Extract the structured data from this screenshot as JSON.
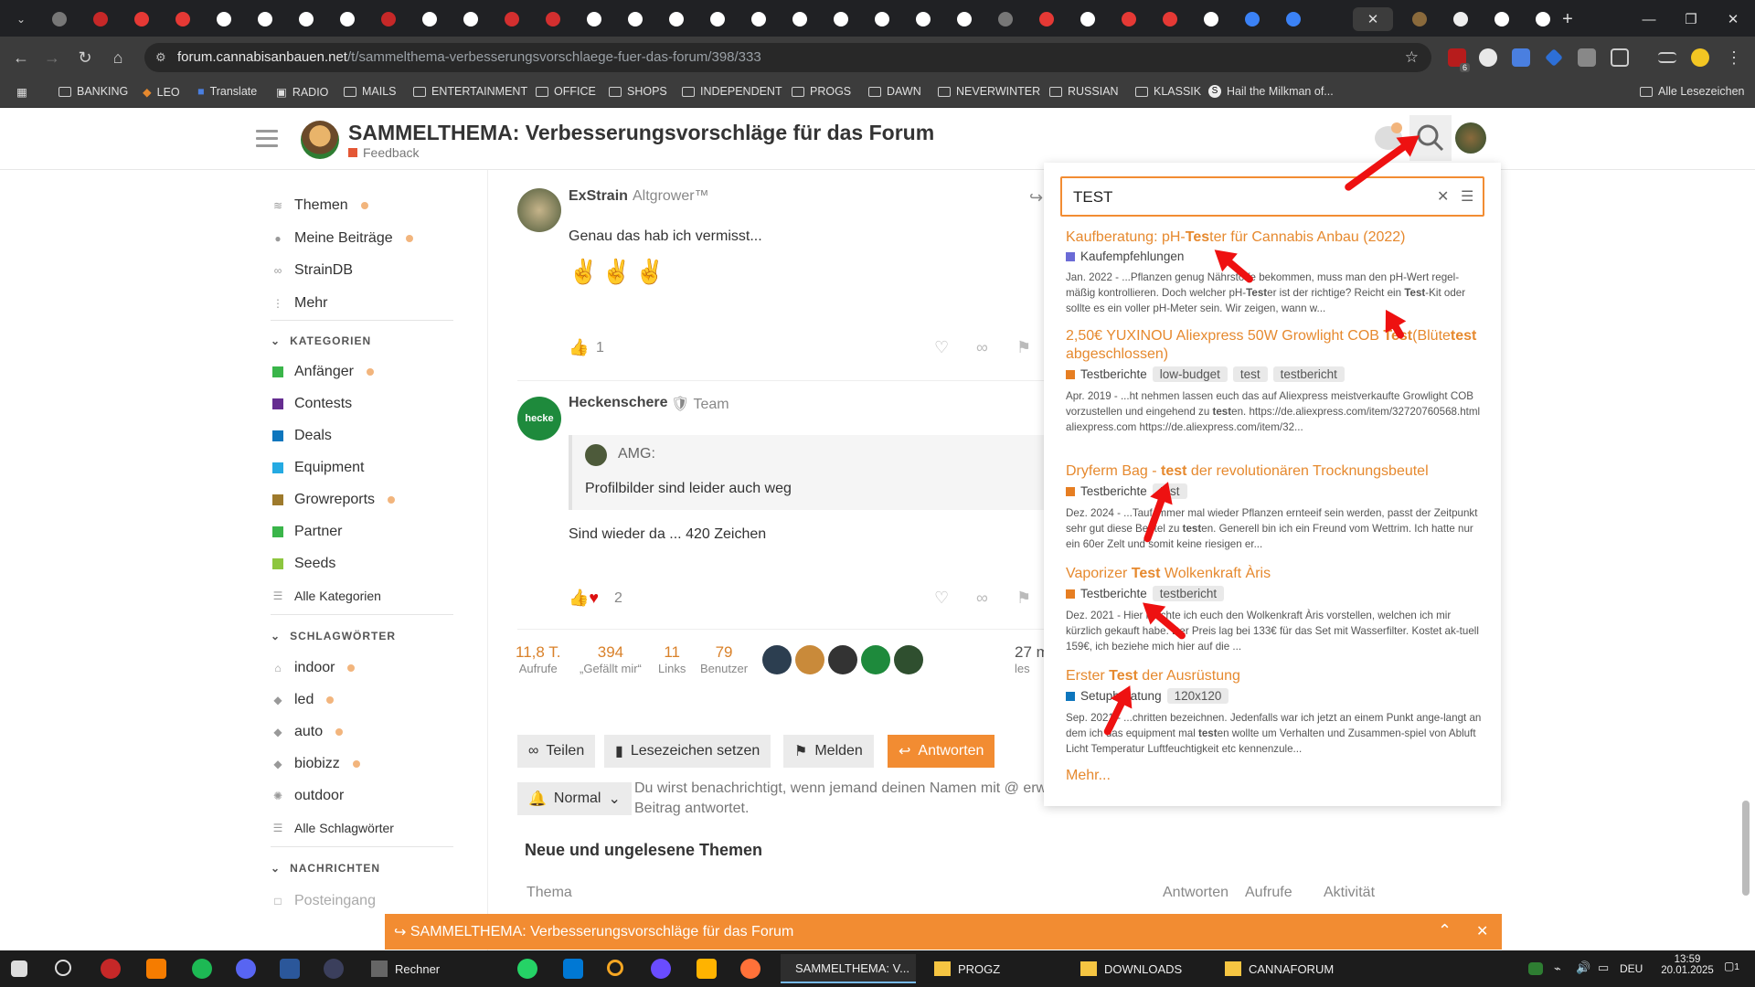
{
  "browser": {
    "url_host": "forum.cannabisanbauen.net",
    "url_path": "/t/sammelthema-verbesserungsvorschlaege-fuer-das-forum/398/333",
    "bookmarks": [
      "BANKING",
      "LEO",
      "Translate",
      "RADIO",
      "MAILS",
      "ENTERTAINMENT",
      "OFFICE",
      "SHOPS",
      "INDEPENDENT",
      "PROGS",
      "DAWN",
      "NEVERWINTER",
      "RUSSIAN",
      "KLASSIK",
      "Hail the Milkman of..."
    ],
    "all_bookmarks": "Alle Lesezeichen",
    "extension_badge": "6"
  },
  "header": {
    "title": "SAMMELTHEMA: Verbesserungsvorschläge für das Forum",
    "category": "Feedback",
    "category_color": "#e45735"
  },
  "sidebar": {
    "top": [
      {
        "label": "Themen",
        "icon": "layers-icon",
        "dot": true
      },
      {
        "label": "Meine Beiträge",
        "icon": "user-icon",
        "dot": true
      },
      {
        "label": "StrainDB",
        "icon": "link-icon",
        "dot": false
      },
      {
        "label": "Mehr",
        "icon": "more-vertical-icon",
        "dot": false
      }
    ],
    "categories_title": "KATEGORIEN",
    "categories": [
      {
        "label": "Anfänger",
        "color": "#3ab54a",
        "dot": true
      },
      {
        "label": "Contests",
        "color": "#652d90",
        "dot": false
      },
      {
        "label": "Deals",
        "color": "#0e76bd",
        "dot": false
      },
      {
        "label": "Equipment",
        "color": "#25aae2",
        "dot": false
      },
      {
        "label": "Growreports",
        "color": "#9e7a2c",
        "dot": true
      },
      {
        "label": "Partner",
        "color": "#3ab54a",
        "dot": false
      },
      {
        "label": "Seeds",
        "color": "#8dc63f",
        "dot": false
      }
    ],
    "all_categories": "Alle Kategorien",
    "tags_title": "SCHLAGWÖRTER",
    "tags": [
      {
        "label": "indoor",
        "icon": "home-icon",
        "dot": true
      },
      {
        "label": "led",
        "icon": "tag-icon",
        "dot": true
      },
      {
        "label": "auto",
        "icon": "tag-icon",
        "dot": true
      },
      {
        "label": "biobizz",
        "icon": "tag-icon",
        "dot": true
      },
      {
        "label": "outdoor",
        "icon": "sun-icon",
        "dot": false
      }
    ],
    "all_tags": "Alle Schlagwörter",
    "messages_title": "NACHRICHTEN",
    "messages_first": "Posteingang"
  },
  "posts": [
    {
      "user": "ExStrain",
      "title": "Altgrower™",
      "text": "Genau das hab ich vermisst...",
      "emoji": "✌✌✌",
      "likes": "1"
    },
    {
      "user": "Heckenschere",
      "title": "Team",
      "quote_user": "AMG:",
      "quote": "Profilbilder sind leider auch weg",
      "text": "Sind wieder da ... 420 Zeichen",
      "likes": "2"
    }
  ],
  "stats": [
    {
      "value": "11,8 T.",
      "label": "Aufrufe"
    },
    {
      "value": "394",
      "label": "„Gefällt mir“"
    },
    {
      "value": "11",
      "label": "Links"
    },
    {
      "value": "79",
      "label": "Benutzer"
    }
  ],
  "stats_extra": {
    "value": "27 m",
    "label": "les"
  },
  "buttons": {
    "share": "Teilen",
    "bookmark": "Lesezeichen setzen",
    "flag": "Melden",
    "reply": "Antworten",
    "notify": "Normal"
  },
  "notify_text_1": "Du wirst benachrichtigt, wenn jemand deinen Namen mit @ erw",
  "notify_text_2": "Beitrag antwortet.",
  "new_topics": {
    "title": "Neue und ungelesene Themen",
    "col_topic": "Thema",
    "col_replies": "Antworten",
    "col_views": "Aufrufe",
    "col_activity": "Aktivität"
  },
  "search": {
    "query": "TEST",
    "more": "Mehr...",
    "results": [
      {
        "title_parts": [
          [
            "Kaufberatung: pH-",
            false
          ],
          [
            "Tes",
            true
          ],
          [
            "ter für Cannabis Anbau (2022)",
            false
          ]
        ],
        "category": "Kaufempfehlungen",
        "cat_color": "#6b6bd6",
        "tags": [],
        "blurb_parts": [
          [
            "Jan. 2022 - ...Pflanzen genug Nährstoffe bekommen, muss man den pH-Wert regel-mäßig kontrollieren. Doch welcher pH-",
            false
          ],
          [
            "Test",
            true
          ],
          [
            "er ist der richtige? Reicht ein ",
            false
          ],
          [
            "Test",
            true
          ],
          [
            "-Kit oder sollte es ein voller pH-Meter sein. Wir zeigen, wann w...",
            false
          ]
        ]
      },
      {
        "title_parts": [
          [
            "2,50€ YUXINOU Aliexpress 50W Growlight COB ",
            false
          ],
          [
            "Test",
            true
          ],
          [
            "(Blüte",
            false
          ],
          [
            "test",
            true
          ],
          [
            " abgeschlossen)",
            false
          ]
        ],
        "category": "Testberichte",
        "cat_color": "#e67e22",
        "tags": [
          "low-budget",
          "test",
          "testbericht"
        ],
        "blurb_parts": [
          [
            "Apr. 2019 - ...ht nehmen lassen euch das auf Aliexpress meistverkaufte Growlight COB vorzustellen und eingehend zu ",
            false
          ],
          [
            "test",
            true
          ],
          [
            "en. https://de.aliexpress.com/item/32720760568.html aliexpress.com https://de.aliexpress.com/item/32...",
            false
          ]
        ]
      },
      {
        "title_parts": [
          [
            "Dryferm Bag - ",
            false
          ],
          [
            "test",
            true
          ],
          [
            " der revolutionären Trocknungsbeutel",
            false
          ]
        ],
        "category": "Testberichte",
        "cat_color": "#e67e22",
        "tags": [
          "test"
        ],
        "blurb_parts": [
          [
            "Dez. 2024 - ...Tauf immer mal wieder Pflanzen ernteeif sein werden, passt der Zeitpunkt sehr gut diese Beutel zu ",
            false
          ],
          [
            "test",
            true
          ],
          [
            "en. Generell bin ich ein Freund vom Wettrim. Ich hatte nur ein 60er Zelt und somit keine riesigen er...",
            false
          ]
        ]
      },
      {
        "title_parts": [
          [
            "Vaporizer ",
            false
          ],
          [
            "Test",
            true
          ],
          [
            " Wolkenkraft Àris",
            false
          ]
        ],
        "category": "Testberichte",
        "cat_color": "#e67e22",
        "tags": [
          "testbericht"
        ],
        "blurb_parts": [
          [
            "Dez. 2021 - Hier möchte ich euch den Wolkenkraft Àris vorstellen, welchen ich mir kürzlich gekauft habe. Der Preis lag bei 133€ für das Set mit Wasserfilter. Kostet ak-tuell 159€, ich beziehe mich hier auf die ...",
            false
          ]
        ]
      },
      {
        "title_parts": [
          [
            "Erster ",
            false
          ],
          [
            "Test",
            true
          ],
          [
            " der Ausrüstung",
            false
          ]
        ],
        "category": "Setupberatung",
        "cat_color": "#0e76bd",
        "tags": [
          "120x120"
        ],
        "blurb_parts": [
          [
            "Sep. 2021 - ...chritten bezeichnen. Jedenfalls war ich jetzt an einem Punkt ange-langt an dem ich das equipment mal ",
            false
          ],
          [
            "test",
            true
          ],
          [
            "en wollte um Verhalten und Zusammen-spiel von Abluft Licht Temperatur Luftfeuchtigkeit etc kennenzule...",
            false
          ]
        ]
      }
    ]
  },
  "banner": "SAMMELTHEMA: Verbesserungsvorschläge für das Forum",
  "taskbar": {
    "apps": [
      {
        "label": "Rechner",
        "active": false
      },
      {
        "label": "SAMMELTHEMA: V...",
        "active": true
      },
      {
        "label": "PROGZ",
        "active": false
      },
      {
        "label": "DOWNLOADS",
        "active": false
      },
      {
        "label": "CANNAFORUM",
        "active": false
      }
    ],
    "lang": "DEU",
    "time": "13:59",
    "date": "20.01.2025",
    "notif": "1"
  }
}
